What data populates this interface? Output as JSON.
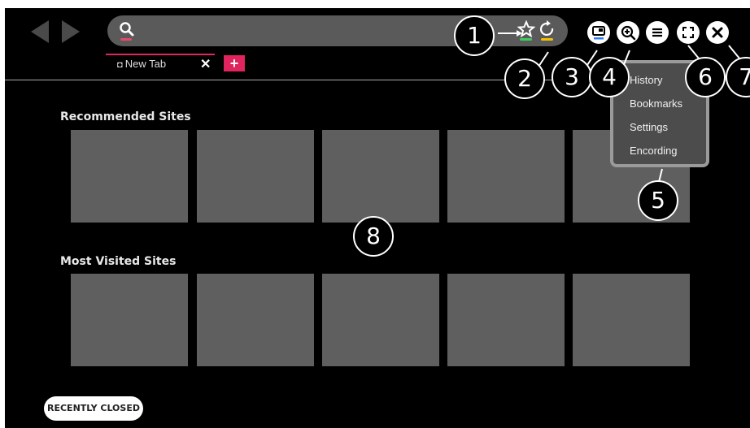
{
  "tab": {
    "label": "New Tab",
    "close": "✕",
    "add": "+"
  },
  "sections": {
    "recommended": {
      "title": "Recommended Sites"
    },
    "most_visited": {
      "title": "Most Visited Sites"
    }
  },
  "menu": {
    "items": [
      "History",
      "Bookmarks",
      "Settings",
      "Encording"
    ]
  },
  "callouts": [
    "1",
    "2",
    "3",
    "4",
    "5",
    "6",
    "7",
    "8"
  ],
  "recently_closed": "RECENTLY CLOSED",
  "recently_closed_chevron": "›",
  "colors": {
    "accent": "#e0245e",
    "search_underline": "#e8496a",
    "bookmark_underline": "#3ecf5e",
    "refresh_underline": "#f2c200",
    "screen_bg": "#000000",
    "tile": "#5f5f5f"
  }
}
